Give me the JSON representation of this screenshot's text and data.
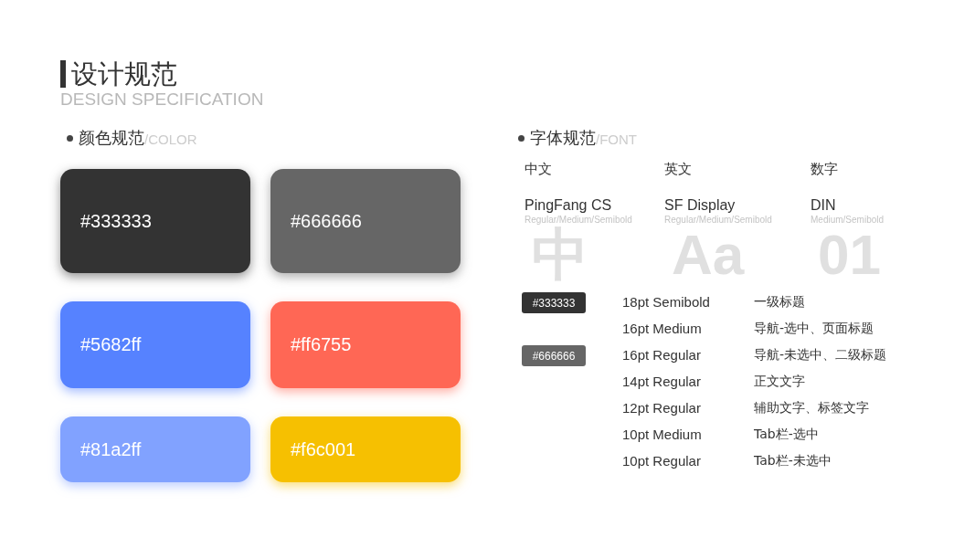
{
  "title": "设计规范",
  "subtitle": "DESIGN SPECIFICATION",
  "color_section": {
    "title": "颜色规范",
    "suffix": "/COLOR",
    "swatches": [
      {
        "label": "#333333",
        "color": "#333333"
      },
      {
        "label": "#666666",
        "color": "#666666"
      },
      {
        "label": "#5682ff",
        "color": "#5682ff"
      },
      {
        "label": "#ff6755",
        "color": "#ff6755"
      },
      {
        "label": "#81a2ff",
        "color": "#81a2ff"
      },
      {
        "label": "#f6c001",
        "color": "#f6c001"
      }
    ]
  },
  "font_section": {
    "title": "字体规范",
    "suffix": "/FONT",
    "fonts": [
      {
        "glyph": "中",
        "label": "中文",
        "name": "PingFang CS",
        "weights": "Regular/Medium/Semibold"
      },
      {
        "glyph": "Aa",
        "label": "英文",
        "name": "SF Display",
        "weights": "Regular/Medium/Semibold"
      },
      {
        "glyph": "01",
        "label": "数字",
        "name": "DIN",
        "weights": "Medium/Semibold"
      }
    ],
    "styles": [
      {
        "badge": {
          "text": "#333333",
          "color": "#333333"
        },
        "size": "18pt Semibold",
        "usage": "一级标题"
      },
      {
        "size": "16pt Medium",
        "usage": "导航-选中、页面标题"
      },
      {
        "badge": {
          "text": "#666666",
          "color": "#666666"
        },
        "size": "16pt Regular",
        "usage": "导航-未选中、二级标题"
      },
      {
        "size": "14pt Regular",
        "usage": "正文文字"
      },
      {
        "size": "12pt Regular",
        "usage": "辅助文字、标签文字"
      },
      {
        "size": "10pt Medium",
        "usage": "Tab栏-选中"
      },
      {
        "size": "10pt Regular",
        "usage": "Tab栏-未选中"
      }
    ]
  }
}
